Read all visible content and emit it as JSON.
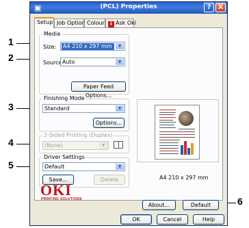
{
  "window": {
    "title": "(PCL) Properties",
    "help_label": "?",
    "close_label": "X"
  },
  "tabs": [
    {
      "label": "Setup"
    },
    {
      "label": "Job Options"
    },
    {
      "label": "Colour"
    },
    {
      "label": "Ask Oki",
      "badge": "i"
    }
  ],
  "media": {
    "group_label": "Media",
    "size_label": "Size:",
    "size_value": "A4 210 x 297 mm",
    "source_label": "Source:",
    "source_value": "Auto",
    "paper_feed_button": "Paper Feed Options..."
  },
  "finishing": {
    "group_label": "Finishing Mode",
    "mode_value": "Standard",
    "options_button": "Options..."
  },
  "duplex": {
    "group_label": "2-Sided Printing (Duplex)",
    "value": "(None)"
  },
  "driver_settings": {
    "group_label": "Driver Settings",
    "value": "Default",
    "save_button": "Save...",
    "delete_button": "Delete"
  },
  "preview": {
    "caption": "A4 210 x 297 mm"
  },
  "footer": {
    "logo_text": "OKI",
    "logo_sub": "PRINTING SOLUTIONS",
    "about_button": "About...",
    "default_button": "Default",
    "ok_button": "OK",
    "cancel_button": "Cancel",
    "help_button": "Help"
  },
  "callouts": [
    "1",
    "2",
    "3",
    "4",
    "5",
    "6"
  ],
  "colors": {
    "title_bar": "#2a63c6",
    "dialog_bg": "#ece9d8",
    "oki_red": "#c01418",
    "selection": "#316ac5"
  }
}
